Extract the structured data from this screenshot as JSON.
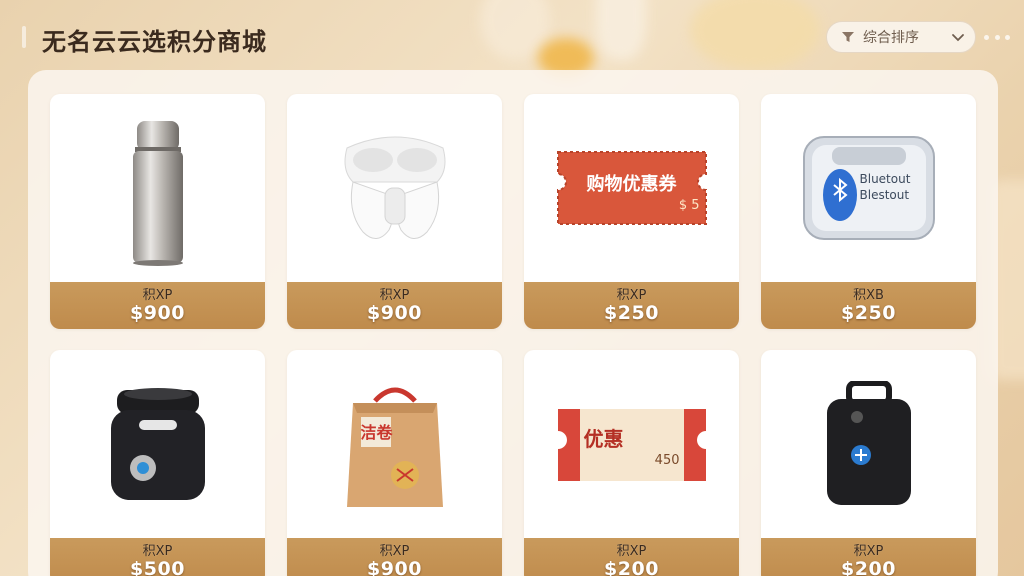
{
  "header": {
    "title": "无名云云选积分商城",
    "filter": {
      "label": "综合排序"
    }
  },
  "colors": {
    "price_band": "#c4914f",
    "title_text": "#3a2a1e",
    "panel_bg": "#fbf5ee"
  },
  "products": [
    {
      "icon": "thermos-bottle-icon",
      "points_label": "积XP",
      "price": "$900"
    },
    {
      "icon": "wireless-earbuds-icon",
      "points_label": "积XP",
      "price": "$900"
    },
    {
      "icon": "shopping-coupon-icon",
      "points_label": "积XP",
      "price": "$250",
      "image_text": "购物优惠券",
      "image_subtext": "$ 5"
    },
    {
      "icon": "bluetooth-earbuds-case-icon",
      "points_label": "积XB",
      "price": "$250",
      "image_text": "Bluetout Blestout"
    },
    {
      "icon": "insulated-food-jar-icon",
      "points_label": "积XP",
      "price": "$500"
    },
    {
      "icon": "gift-bag-icon",
      "points_label": "积XP",
      "price": "$900",
      "image_text": "洁卷"
    },
    {
      "icon": "discount-ticket-icon",
      "points_label": "积XP",
      "price": "$200",
      "image_text": "优惠",
      "image_subtext": "450"
    },
    {
      "icon": "bluetooth-tracker-icon",
      "points_label": "积XP",
      "price": "$200"
    }
  ]
}
